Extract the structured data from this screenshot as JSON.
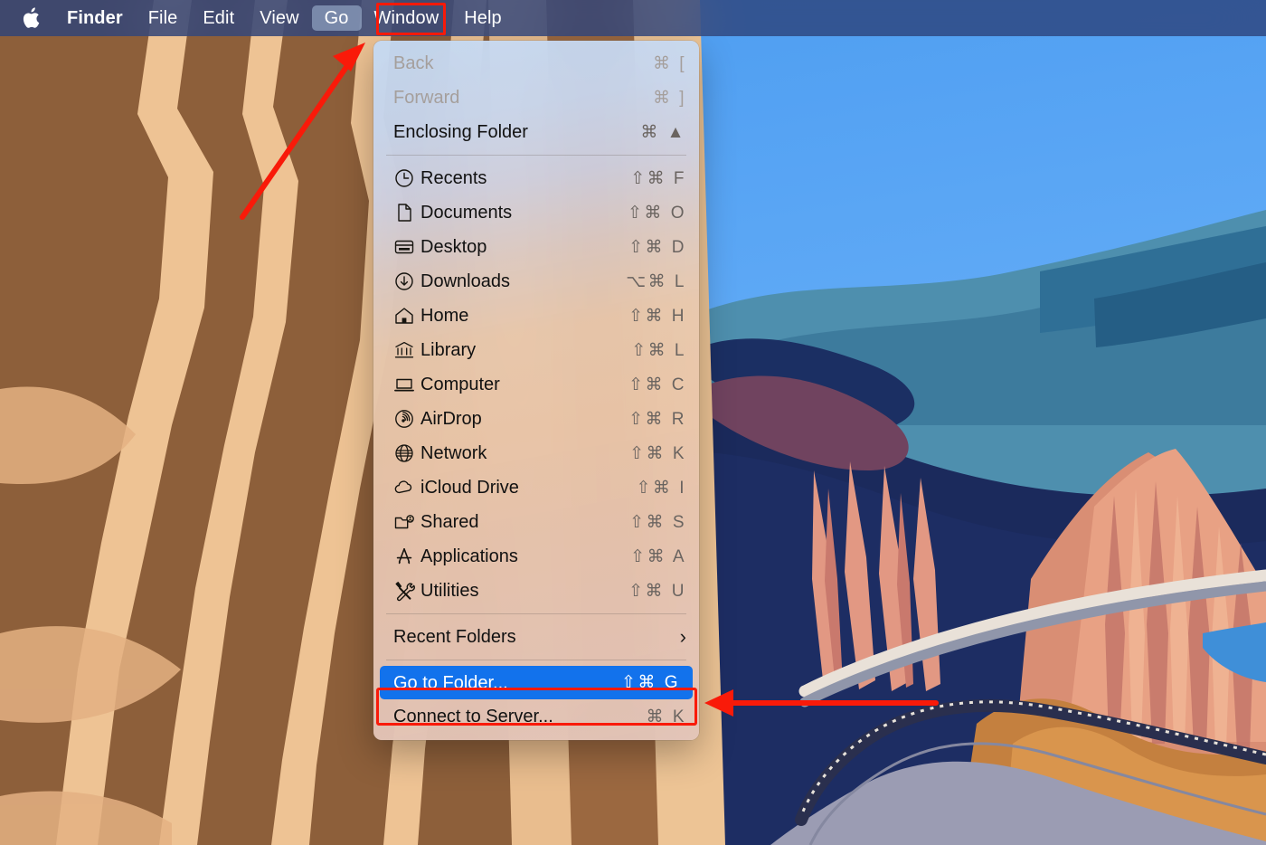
{
  "menubar": {
    "apple_icon": "apple-logo-icon",
    "items": [
      {
        "label": "Finder",
        "bold": true,
        "active": false
      },
      {
        "label": "File",
        "bold": false,
        "active": false
      },
      {
        "label": "Edit",
        "bold": false,
        "active": false
      },
      {
        "label": "View",
        "bold": false,
        "active": false
      },
      {
        "label": "Go",
        "bold": false,
        "active": true
      },
      {
        "label": "Window",
        "bold": false,
        "active": false
      },
      {
        "label": "Help",
        "bold": false,
        "active": false
      }
    ]
  },
  "go_menu": {
    "items": [
      {
        "label": "Back",
        "shortcut": "⌘ [",
        "icon": null,
        "state": "disabled"
      },
      {
        "label": "Forward",
        "shortcut": "⌘ ]",
        "icon": null,
        "state": "disabled"
      },
      {
        "label": "Enclosing Folder",
        "shortcut": "⌘ ▲",
        "icon": null,
        "state": "normal"
      },
      {
        "label": "Recents",
        "shortcut": "⇧⌘ F",
        "icon": "clock-icon",
        "state": "normal"
      },
      {
        "label": "Documents",
        "shortcut": "⇧⌘ O",
        "icon": "document-icon",
        "state": "normal"
      },
      {
        "label": "Desktop",
        "shortcut": "⇧⌘ D",
        "icon": "desktop-icon",
        "state": "normal"
      },
      {
        "label": "Downloads",
        "shortcut": "⌥⌘ L",
        "icon": "download-icon",
        "state": "normal"
      },
      {
        "label": "Home",
        "shortcut": "⇧⌘ H",
        "icon": "home-icon",
        "state": "normal"
      },
      {
        "label": "Library",
        "shortcut": "⇧⌘ L",
        "icon": "library-icon",
        "state": "normal"
      },
      {
        "label": "Computer",
        "shortcut": "⇧⌘ C",
        "icon": "computer-icon",
        "state": "normal"
      },
      {
        "label": "AirDrop",
        "shortcut": "⇧⌘ R",
        "icon": "airdrop-icon",
        "state": "normal"
      },
      {
        "label": "Network",
        "shortcut": "⇧⌘ K",
        "icon": "globe-icon",
        "state": "normal"
      },
      {
        "label": "iCloud Drive",
        "shortcut": "⇧⌘ I",
        "icon": "cloud-icon",
        "state": "normal"
      },
      {
        "label": "Shared",
        "shortcut": "⇧⌘ S",
        "icon": "shared-folder-icon",
        "state": "normal"
      },
      {
        "label": "Applications",
        "shortcut": "⇧⌘ A",
        "icon": "applications-icon",
        "state": "normal"
      },
      {
        "label": "Utilities",
        "shortcut": "⇧⌘ U",
        "icon": "utilities-icon",
        "state": "normal"
      },
      {
        "label": "Recent Folders",
        "shortcut": "›",
        "icon": null,
        "state": "submenu"
      },
      {
        "label": "Go to Folder...",
        "shortcut": "⇧⌘ G",
        "icon": null,
        "state": "selected"
      },
      {
        "label": "Connect to Server...",
        "shortcut": "⌘ K",
        "icon": null,
        "state": "normal"
      }
    ]
  },
  "annotations": {
    "highlight_color": "#f91a09",
    "selection_color": "#1272ec",
    "menubar_highlight_color": "#bed7f5",
    "arrow_to_go_menu": "arrow-pointing-to-go-menu",
    "arrow_to_go_to_folder": "arrow-pointing-to-go-to-folder"
  }
}
